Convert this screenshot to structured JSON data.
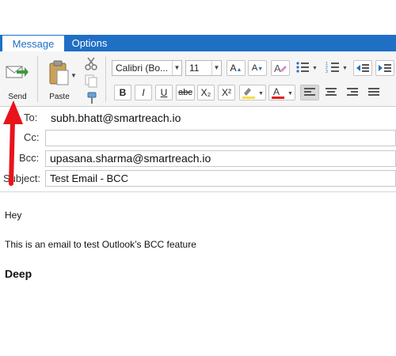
{
  "ribbon": {
    "tabs": [
      {
        "label": "Message"
      },
      {
        "label": "Options"
      }
    ],
    "send_label": "Send",
    "paste_label": "Paste",
    "font_name": "Calibri (Bo...",
    "font_size": "11",
    "format_buttons": {
      "bold": "B",
      "italic": "I",
      "underline": "U",
      "strikethrough": "abc",
      "subscript": "X₂",
      "superscript": "X²"
    }
  },
  "header": {
    "to_label": "To:",
    "to_value": "subh.bhatt@smartreach.io",
    "cc_label": "Cc:",
    "cc_value": "",
    "bcc_label": "Bcc:",
    "bcc_value": "upasana.sharma@smartreach.io",
    "subject_label": "Subject:",
    "subject_value": "Test Email - BCC"
  },
  "body": {
    "greeting": "Hey",
    "message": "This is an email to test Outlook’s BCC feature",
    "signature": "Deep"
  },
  "colors": {
    "tab_bar": "#1f6fc5",
    "arrow": "#e8141c",
    "highlight": "#f7e03c",
    "font_color": "#e8141c"
  }
}
